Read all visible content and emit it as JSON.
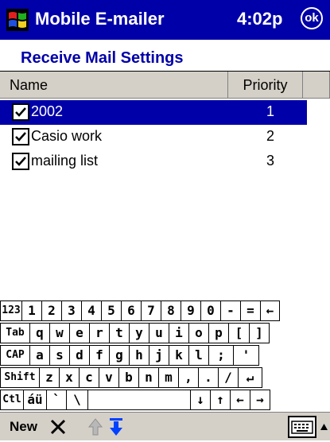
{
  "titlebar": {
    "app_title": "Mobile E-mailer",
    "time": "4:02p",
    "ok_label": "ok",
    "icons": {
      "start": "windows-flag-icon"
    }
  },
  "page": {
    "title": "Receive Mail Settings"
  },
  "table": {
    "columns": [
      "Name",
      "Priority"
    ],
    "rows": [
      {
        "name": "2002",
        "priority": "1",
        "checked": true,
        "selected": true
      },
      {
        "name": "Casio work",
        "priority": "2",
        "checked": true,
        "selected": false
      },
      {
        "name": "mailing list",
        "priority": "3",
        "checked": true,
        "selected": false
      }
    ]
  },
  "keyboard": {
    "rows": [
      [
        "123",
        "1",
        "2",
        "3",
        "4",
        "5",
        "6",
        "7",
        "8",
        "9",
        "0",
        "-",
        "=",
        "←"
      ],
      [
        "Tab",
        "q",
        "w",
        "e",
        "r",
        "t",
        "y",
        "u",
        "i",
        "o",
        "p",
        "[",
        "]"
      ],
      [
        "CAP",
        "a",
        "s",
        "d",
        "f",
        "g",
        "h",
        "j",
        "k",
        "l",
        ";",
        "'"
      ],
      [
        "Shift",
        "z",
        "x",
        "c",
        "v",
        "b",
        "n",
        "m",
        ",",
        ".",
        "/",
        "↵"
      ],
      [
        "Ctl",
        "áü",
        "`",
        "\\",
        "",
        "↓",
        "↑",
        "←",
        "→"
      ]
    ]
  },
  "menubar": {
    "new_label": "New",
    "icons": [
      "delete-x-icon",
      "move-up-icon",
      "move-down-icon",
      "keyboard-icon",
      "input-arrow-icon"
    ]
  },
  "colors": {
    "title_bg": "#0000a8",
    "selection": "#0000a8",
    "header_text": "#0000a8",
    "bar_gray": "#d4d0c8"
  }
}
